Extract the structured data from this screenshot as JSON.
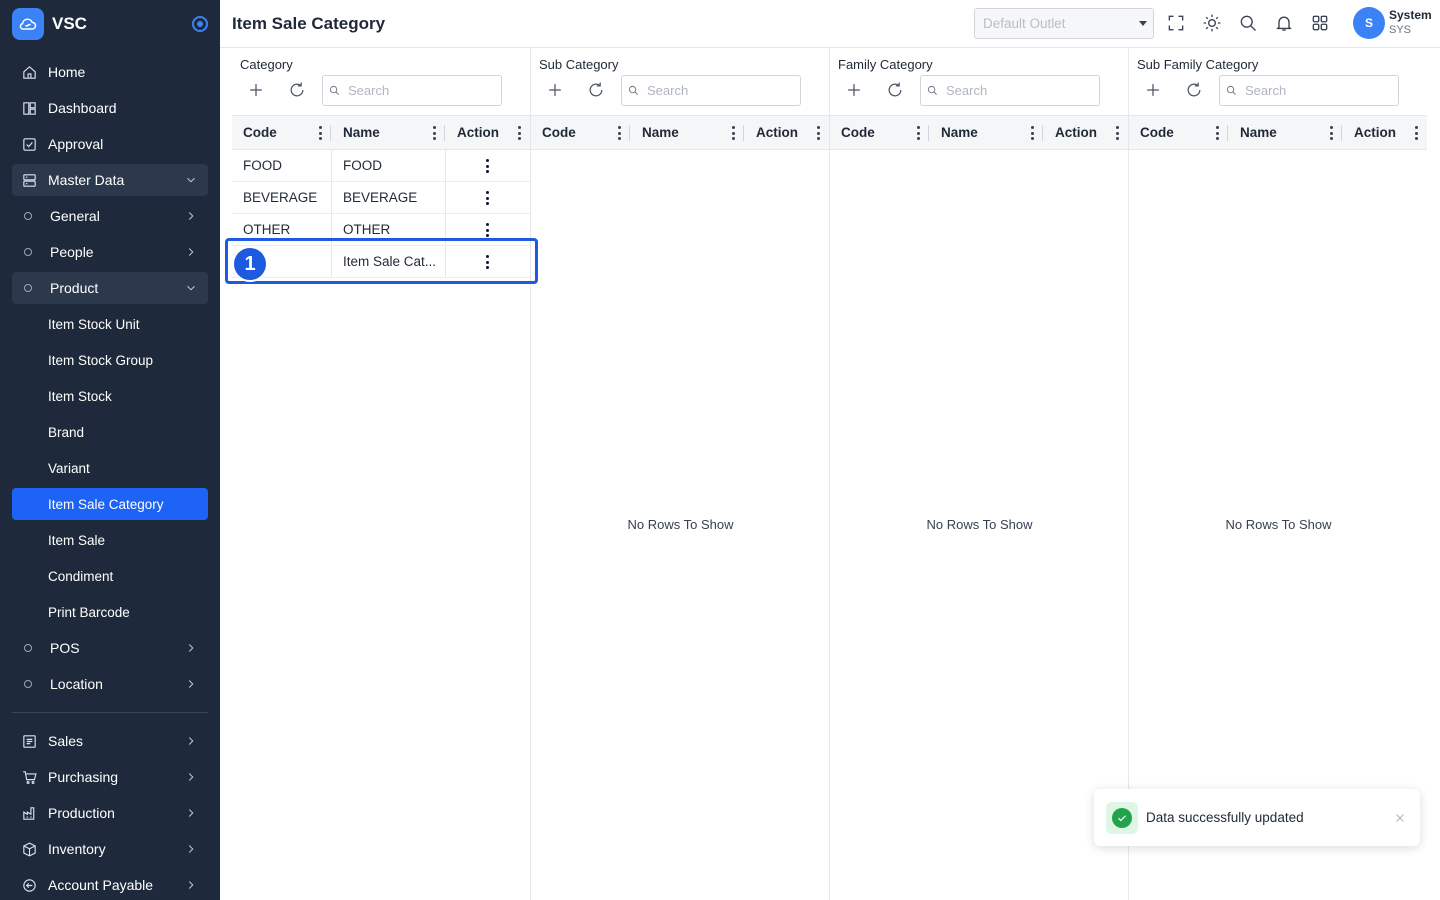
{
  "app": {
    "name": "VSC"
  },
  "header": {
    "title": "Item Sale Category",
    "outlet_placeholder": "Default Outlet",
    "user_name": "System",
    "user_code": "SYS",
    "avatar_letter": "S"
  },
  "sidebar": {
    "home": "Home",
    "dashboard": "Dashboard",
    "approval": "Approval",
    "master_data": "Master Data",
    "general": "General",
    "people": "People",
    "product": "Product",
    "product_items": [
      "Item Stock Unit",
      "Item Stock Group",
      "Item Stock",
      "Brand",
      "Variant",
      "Item Sale Category",
      "Item Sale",
      "Condiment",
      "Print Barcode"
    ],
    "pos": "POS",
    "location": "Location",
    "sales": "Sales",
    "purchasing": "Purchasing",
    "production": "Production",
    "inventory": "Inventory",
    "account_payable": "Account Payable"
  },
  "panels": [
    {
      "title": "Category",
      "search_placeholder": "Search"
    },
    {
      "title": "Sub Category",
      "search_placeholder": "Search"
    },
    {
      "title": "Family Category",
      "search_placeholder": "Search"
    },
    {
      "title": "Sub Family Category",
      "search_placeholder": "Search"
    }
  ],
  "columns": {
    "code": "Code",
    "name": "Name",
    "action": "Action"
  },
  "category_rows": [
    {
      "code": "FOOD",
      "name": "FOOD"
    },
    {
      "code": "BEVERAGE",
      "name": "BEVERAGE"
    },
    {
      "code": "OTHER",
      "name": "OTHER"
    },
    {
      "code": "",
      "name": "Item Sale Cat..."
    }
  ],
  "empty_message": "No Rows To Show",
  "annotation": {
    "step": "1"
  },
  "toast": {
    "message": "Data successfully updated"
  },
  "colors": {
    "sidebar_bg": "#1e2a3b",
    "active": "#1d63f5",
    "accent": "#3b82f6",
    "success": "#22a44c",
    "highlight": "#1d5ae0"
  }
}
